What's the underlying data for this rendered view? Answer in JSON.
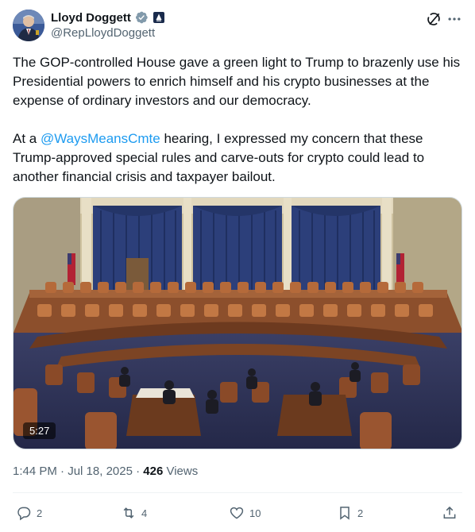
{
  "author": {
    "display_name": "Lloyd Doggett",
    "handle": "@RepLloydDoggett"
  },
  "tweet": {
    "paragraph1": "The GOP-controlled House gave a green light to Trump to brazenly use his Presidential powers to enrich himself and his crypto businesses at the expense of ordinary investors and our democracy.",
    "paragraph2_before": "At a ",
    "mention": "@WaysMeansCmte",
    "paragraph2_after": " hearing, I expressed my concern that these Trump-approved special rules and carve-outs for crypto could lead to another financial crisis and taxpayer bailout."
  },
  "media": {
    "duration": "5:27"
  },
  "meta": {
    "time": "1:44 PM",
    "separator": " · ",
    "date": "Jul 18, 2025",
    "separator2": " · ",
    "views_count": "426",
    "views_label": " Views"
  },
  "actions": {
    "replies": "2",
    "reposts": "4",
    "likes": "10",
    "bookmarks": "2"
  },
  "icons": [
    "verified-badge-icon",
    "government-badge-icon",
    "grok-icon",
    "more-icon",
    "reply-icon",
    "repost-icon",
    "like-icon",
    "bookmark-icon",
    "share-icon"
  ],
  "colors": {
    "link": "#1d9bf0",
    "secondary_text": "#536471",
    "primary_text": "#0f1419"
  }
}
